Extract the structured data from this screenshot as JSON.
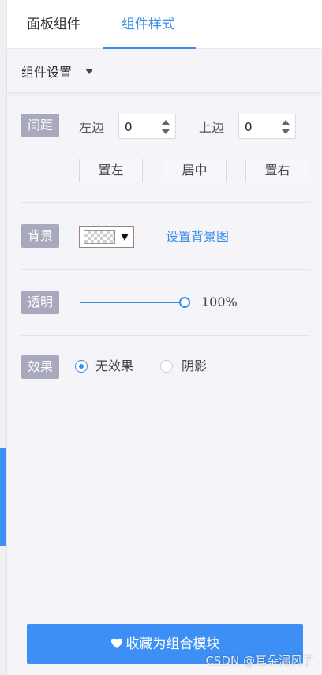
{
  "tabs": [
    {
      "label": "面板组件"
    },
    {
      "label": "组件样式"
    }
  ],
  "active_tab_color": "#3a8ee6",
  "settings": {
    "title": "组件设置"
  },
  "spacing": {
    "tag": "间距",
    "left_label": "左边",
    "left_value": "0",
    "top_label": "上边",
    "top_value": "0",
    "align_buttons": [
      "置左",
      "居中",
      "置右"
    ]
  },
  "background": {
    "tag": "背景",
    "set_image_link": "设置背景图"
  },
  "opacity": {
    "tag": "透明",
    "value_text": "100%",
    "value": 100
  },
  "effect": {
    "tag": "效果",
    "options": [
      {
        "label": "无效果",
        "checked": true
      },
      {
        "label": "阴影",
        "checked": false
      }
    ]
  },
  "footer": {
    "button_label": "收藏为组合模块",
    "button_color": "#3d8ff5"
  },
  "watermark": "CSDN @耳朵漏风了"
}
